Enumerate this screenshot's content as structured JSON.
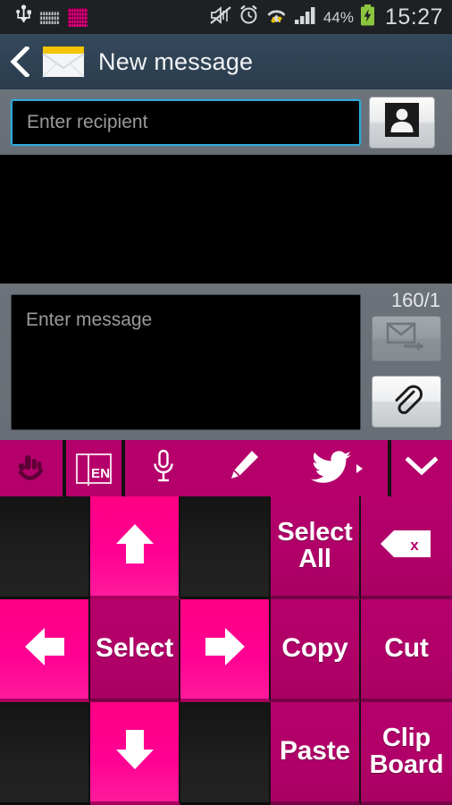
{
  "status_bar": {
    "time": "15:27",
    "battery_percent": "44%",
    "icons": [
      "usb-icon",
      "keyboard-icon",
      "pink-keyboard-icon",
      "mute-icon",
      "alarm-icon",
      "wifi-icon",
      "signal-icon",
      "battery-charging-icon"
    ]
  },
  "title_bar": {
    "back_label": "‹",
    "title": "New message",
    "app_icon": "envelope-icon"
  },
  "recipient": {
    "placeholder": "Enter recipient",
    "value": "",
    "contacts_button_icon": "contact-person-icon"
  },
  "compose": {
    "placeholder": "Enter message",
    "value": "",
    "counter": "160/1",
    "send_button_icon": "send-message-icon",
    "attach_button_icon": "paperclip-icon"
  },
  "keyboard_toolbar": {
    "items": [
      {
        "name": "handwriting-icon",
        "label": ""
      },
      {
        "name": "language-key",
        "label": "EN"
      },
      {
        "name": "microphone-icon",
        "label": ""
      },
      {
        "name": "pencil-icon",
        "label": ""
      },
      {
        "name": "twitter-icon",
        "label": ""
      },
      {
        "name": "chevron-down-icon",
        "label": ""
      }
    ],
    "language": "EN"
  },
  "keypad": {
    "rows": [
      [
        {
          "name": "blank-key",
          "label": "",
          "style": "blank",
          "icon": ""
        },
        {
          "name": "arrow-up-key",
          "label": "",
          "style": "hot",
          "icon": "arrow-up-icon"
        },
        {
          "name": "blank-key",
          "label": "",
          "style": "blank",
          "icon": ""
        },
        {
          "name": "select-all-key",
          "label": "Select All",
          "style": "dark",
          "icon": ""
        },
        {
          "name": "backspace-key",
          "label": "",
          "style": "dark",
          "icon": "backspace-icon"
        }
      ],
      [
        {
          "name": "arrow-left-key",
          "label": "",
          "style": "hot",
          "icon": "arrow-left-icon"
        },
        {
          "name": "select-key",
          "label": "Select",
          "style": "dark",
          "icon": ""
        },
        {
          "name": "arrow-right-key",
          "label": "",
          "style": "hot",
          "icon": "arrow-right-icon"
        },
        {
          "name": "copy-key",
          "label": "Copy",
          "style": "dark",
          "icon": ""
        },
        {
          "name": "cut-key",
          "label": "Cut",
          "style": "dark",
          "icon": ""
        }
      ],
      [
        {
          "name": "blank-key",
          "label": "",
          "style": "blank",
          "icon": ""
        },
        {
          "name": "arrow-down-key",
          "label": "",
          "style": "hot",
          "icon": "arrow-down-icon"
        },
        {
          "name": "blank-key",
          "label": "",
          "style": "blank",
          "icon": ""
        },
        {
          "name": "paste-key",
          "label": "Paste",
          "style": "dark",
          "icon": ""
        },
        {
          "name": "clipboard-key",
          "label": "Clip Board",
          "style": "dark",
          "icon": ""
        }
      ]
    ]
  },
  "colors": {
    "accent_hot_pink": "#ff0090",
    "accent_magenta": "#b5006b",
    "title_bar": "#2f4254",
    "panel_gray": "#6d737a",
    "focus_border": "#2fa8d8"
  }
}
